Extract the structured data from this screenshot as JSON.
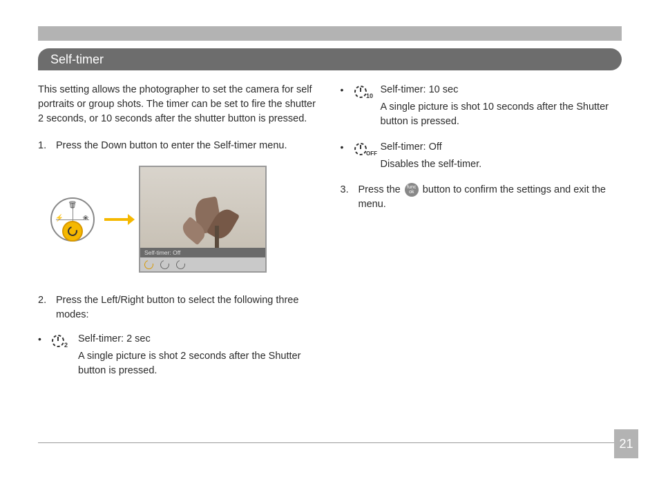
{
  "section_title": "Self-timer",
  "intro": "This setting allows the photographer to set the camera for self portraits or group shots. The timer can be set to fire the shutter 2 seconds, or 10 seconds after the shutter button is pressed.",
  "step1_num": "1.",
  "step1_text": "Press the Down button to enter the Self-timer menu.",
  "preview_bar_text": "Self-timer: Off",
  "step2_num": "2.",
  "step2_text": "Press the Left/Right button to select the following three modes:",
  "mode_2sec": {
    "icon_sub": "2",
    "title": "Self-timer: 2 sec",
    "desc": "A single picture is shot 2 seconds after the Shutter button is pressed."
  },
  "mode_10sec": {
    "icon_sub": "10",
    "title": "Self-timer: 10 sec",
    "desc": "A single picture is shot 10 seconds after the Shutter button is pressed."
  },
  "mode_off": {
    "icon_sub": "OFF",
    "title": "Self-timer: Off",
    "desc": "Disables the self-timer."
  },
  "step3_num": "3.",
  "step3_before": "Press the ",
  "func_button_label": "func ok",
  "step3_after": " button to confirm the settings and exit the menu.",
  "page_number": "21"
}
